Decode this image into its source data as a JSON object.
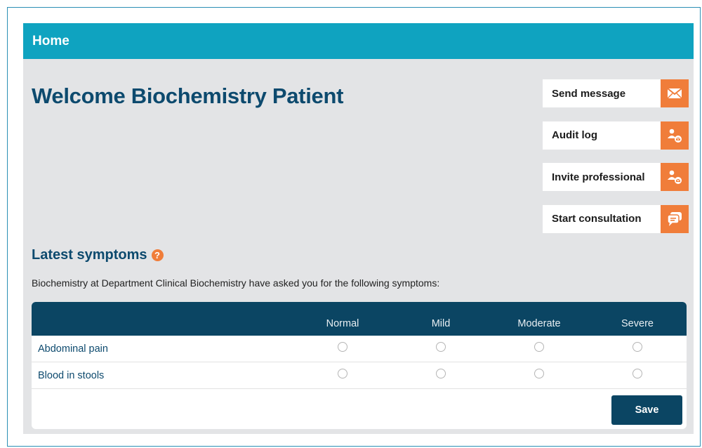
{
  "header": {
    "title": "Home"
  },
  "welcome": {
    "title": "Welcome Biochemistry Patient"
  },
  "actions": [
    {
      "label": "Send message",
      "icon": "envelope-icon"
    },
    {
      "label": "Audit log",
      "icon": "person-message-icon"
    },
    {
      "label": "Invite professional",
      "icon": "person-message-icon"
    },
    {
      "label": "Start consultation",
      "icon": "chat-bubbles-icon"
    }
  ],
  "symptoms": {
    "heading": "Latest symptoms",
    "help_icon": "question-icon",
    "help_glyph": "?",
    "description": "Biochemistry at Department Clinical Biochemistry have asked you for the following symptoms:",
    "columns": [
      "Normal",
      "Mild",
      "Moderate",
      "Severe"
    ],
    "rows": [
      {
        "label": "Abdominal pain"
      },
      {
        "label": "Blood in stools"
      }
    ],
    "save_label": "Save"
  },
  "colors": {
    "header_bg": "#0fa3c0",
    "accent": "#f07d3a",
    "navy": "#0b4563",
    "heading_text": "#0d4a6e",
    "app_bg": "#e3e4e6"
  }
}
